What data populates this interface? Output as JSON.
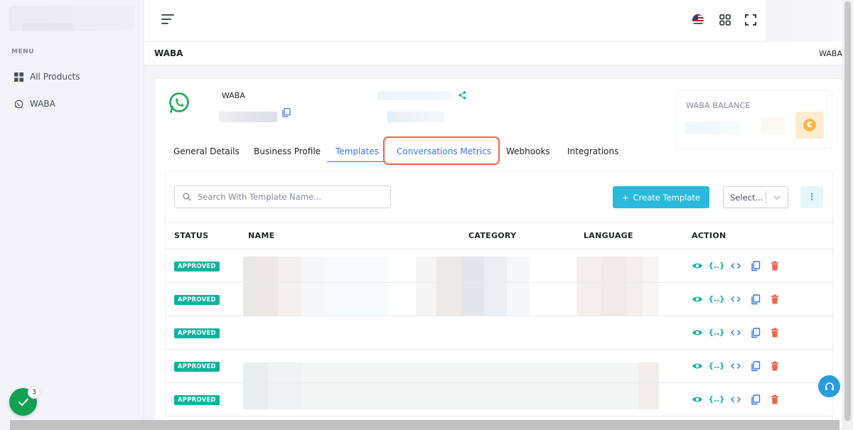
{
  "sidebar": {
    "menu_title": "MENU",
    "items": [
      {
        "label": "All Products",
        "icon": "grid-icon"
      },
      {
        "label": "WABA",
        "icon": "whatsapp-icon"
      }
    ]
  },
  "header": {
    "language": "us-flag",
    "icons": [
      "apps-grid-icon",
      "fullscreen-icon"
    ]
  },
  "page": {
    "title": "WABA",
    "breadcrumb": "WABA"
  },
  "account": {
    "name": "WABA",
    "balance_title": "WABA BALANCE",
    "currency_symbol": "€"
  },
  "tabs": [
    {
      "label": "General Details"
    },
    {
      "label": "Business Profile"
    },
    {
      "label": "Templates",
      "active": true
    },
    {
      "label": "Conversations Metrics",
      "highlighted": true
    },
    {
      "label": "Webhooks"
    },
    {
      "label": "Integrations"
    }
  ],
  "toolbar": {
    "search_placeholder": "Search With Template Name...",
    "create_label": "Create Template",
    "select_value": "Select..."
  },
  "table": {
    "columns": [
      "STATUS",
      "NAME",
      "CATEGORY",
      "LANGUAGE",
      "ACTION"
    ],
    "rows": [
      {
        "status": "APPROVED"
      },
      {
        "status": "APPROVED"
      },
      {
        "status": "APPROVED"
      },
      {
        "status": "APPROVED"
      },
      {
        "status": "APPROVED"
      }
    ],
    "actions": [
      "eye-icon",
      "variables-icon",
      "code-icon",
      "copy-icon",
      "trash-icon"
    ],
    "variables_label": "{..}"
  },
  "notifications": {
    "count": "3"
  },
  "colors": {
    "accent": "#3577f1",
    "success": "#0ab39c",
    "info": "#29badb",
    "danger": "#f06548",
    "highlight_border": "#f06548"
  }
}
